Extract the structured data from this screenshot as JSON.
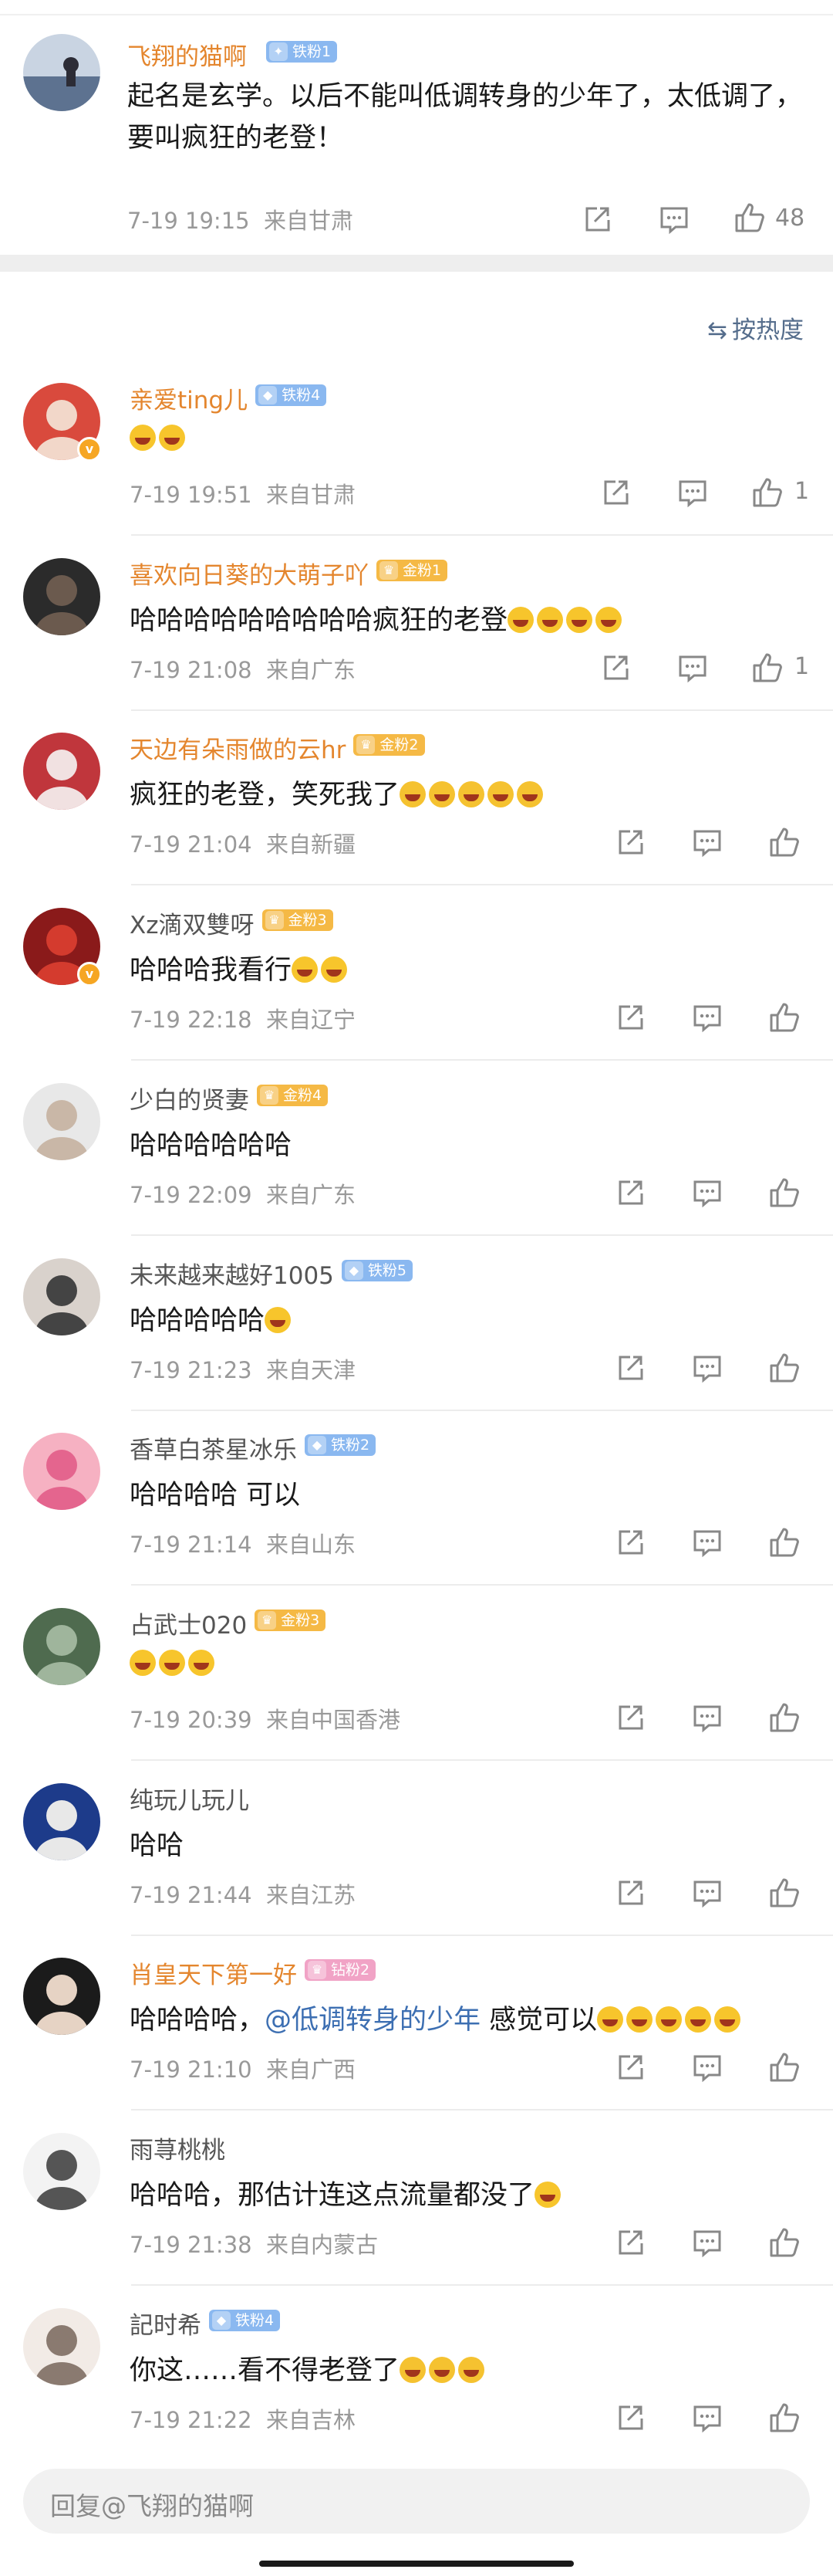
{
  "original": {
    "author": "飞翔的猫啊",
    "badge": "铁粉1",
    "text": "起名是玄学。以后不能叫低调转身的少年了，太低调了，要叫疯狂的老登！",
    "time": "7-19 19:15",
    "location": "来自甘肃",
    "likes": "48"
  },
  "sort_label": "按热度",
  "comments": [
    {
      "author": "亲爱ting儿",
      "badge": "铁粉4",
      "text": "",
      "emojis": 2,
      "time": "7-19 19:51",
      "location": "来自甘肃",
      "likes": "1"
    },
    {
      "author": "喜欢向日葵的大萌子吖",
      "badge": "金粉1",
      "text": "哈哈哈哈哈哈哈哈哈疯狂的老登",
      "emojis": 4,
      "time": "7-19 21:08",
      "location": "来自广东",
      "likes": "1"
    },
    {
      "author": "天边有朵雨做的云hr",
      "badge": "金粉2",
      "text": "疯狂的老登，笑死我了",
      "emojis": 5,
      "time": "7-19 21:04",
      "location": "来自新疆",
      "likes": ""
    },
    {
      "author": "Xz滴双雙呀",
      "badge": "金粉3",
      "text": "哈哈哈我看行",
      "emojis": 2,
      "time": "7-19 22:18",
      "location": "来自辽宁",
      "likes": ""
    },
    {
      "author": "少白的贤妻",
      "badge": "金粉4",
      "text": "哈哈哈哈哈哈",
      "emojis": 0,
      "time": "7-19 22:09",
      "location": "来自广东",
      "likes": ""
    },
    {
      "author": "未来越来越好1005",
      "badge": "铁粉5",
      "text": "哈哈哈哈哈",
      "emojis": 1,
      "time": "7-19 21:23",
      "location": "来自天津",
      "likes": ""
    },
    {
      "author": "香草白茶星冰乐",
      "badge": "铁粉2",
      "text": "哈哈哈哈 可以",
      "emojis": 0,
      "time": "7-19 21:14",
      "location": "来自山东",
      "likes": ""
    },
    {
      "author": "占武士020",
      "badge": "金粉3",
      "text": "",
      "emojis": 3,
      "time": "7-19 20:39",
      "location": "来自中国香港",
      "likes": ""
    },
    {
      "author": "纯玩儿玩儿",
      "badge": "",
      "text": "哈哈",
      "emojis": 0,
      "time": "7-19 21:44",
      "location": "来自江苏",
      "likes": ""
    },
    {
      "author": "肖皇天下第一好",
      "badge": "钻粉2",
      "text_before": "哈哈哈哈，",
      "mention": "@低调转身的少年",
      "text_after": " 感觉可以",
      "emojis": 5,
      "time": "7-19 21:10",
      "location": "来自广西",
      "likes": ""
    },
    {
      "author": "雨荨桃桃",
      "badge": "",
      "text": "哈哈哈，那估计连这点流量都没了",
      "emojis": 1,
      "time": "7-19 21:38",
      "location": "来自内蒙古",
      "likes": ""
    },
    {
      "author": "記时希",
      "badge": "铁粉4",
      "text": "你这……看不得老登了",
      "emojis": 3,
      "time": "7-19 21:22",
      "location": "来自吉林",
      "likes": ""
    }
  ],
  "reply_placeholder": "回复@飞翔的猫啊"
}
